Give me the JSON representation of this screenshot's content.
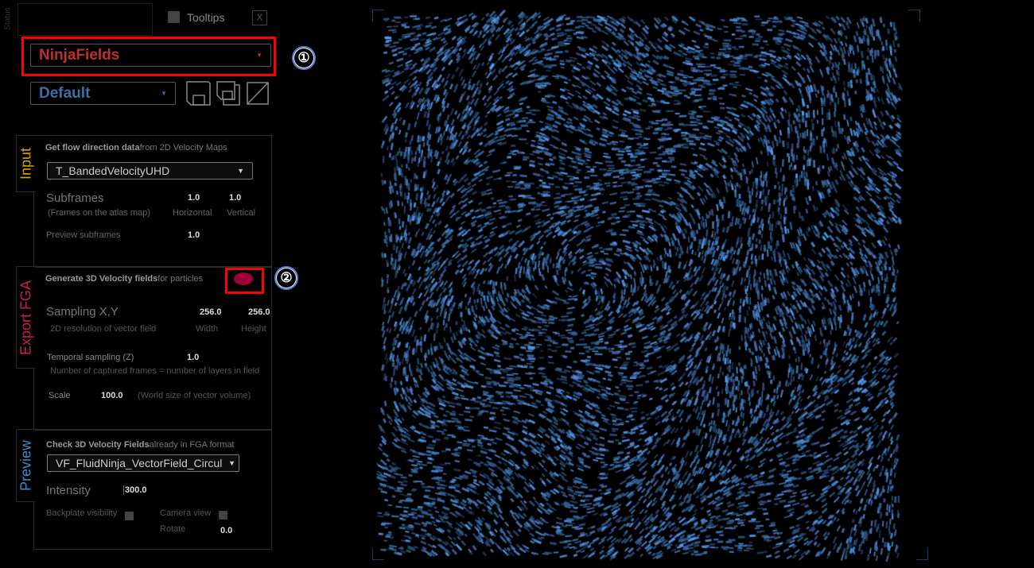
{
  "status_label": "Status",
  "tooltips_label": "Tooltips",
  "close_label": "X",
  "module_dropdown": {
    "value": "NinjaFields"
  },
  "preset_dropdown": {
    "value": "Default"
  },
  "annotations": [
    "①",
    "②"
  ],
  "input": {
    "tab": "Input",
    "heading_bold": "Get flow direction data",
    "heading_rest": "from 2D Velocity Maps",
    "texture_dropdown": "T_BandedVelocityUHD",
    "subframes_label": "Subframes",
    "subframes_desc": "(Frames on the atlas map)",
    "horizontal_value": "1.0",
    "horizontal_label": "Horizontal",
    "vertical_value": "1.0",
    "vertical_label": "Vertical",
    "preview_subframes_label": "Preview subframes",
    "preview_subframes_value": "1.0"
  },
  "export": {
    "tab": "Export FGA",
    "heading_bold": "Generate 3D Velocity fields",
    "heading_rest": "for particles",
    "sampling_label": "Sampling X,Y",
    "sampling_desc": "2D resolution of vector field",
    "width_value": "256.0",
    "width_label": "Width",
    "height_value": "256.0",
    "height_label": "Height",
    "temporal_label": "Temporal sampling (Z)",
    "temporal_value": "1.0",
    "temporal_desc": "Number of captured frames = number of layers in field",
    "scale_label": "Scale",
    "scale_value": "100.0",
    "scale_desc": "(World size of vector volume)",
    "record_color": "#a0003a"
  },
  "preview": {
    "tab": "Preview",
    "heading_bold": "Check 3D Velocity Fields",
    "heading_rest": "already in FGA format",
    "field_dropdown": "VF_FluidNinja_VectorField_Circul",
    "intensity_label": "Intensity",
    "intensity_value": "300.0",
    "backplate_label": "Backplate visibility",
    "camera_label": "Camera view",
    "rotate_label": "Rotate",
    "rotate_value": "0.0"
  },
  "colors": {
    "input": "#d9a400",
    "export": "#c8204a",
    "preview": "#3a8ad0",
    "module": "#c0302a",
    "preset": "#3e6ea8",
    "highlight": "#ff0000"
  }
}
